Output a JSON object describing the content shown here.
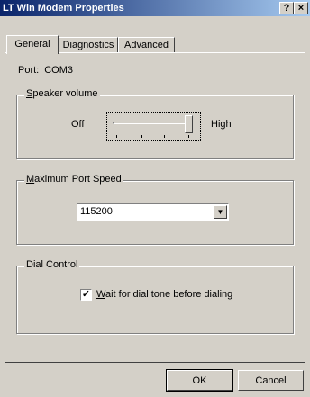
{
  "window": {
    "title": "LT Win Modem Properties",
    "help_glyph": "?",
    "close_glyph": "×"
  },
  "tabs": [
    {
      "label": "General",
      "active": true
    },
    {
      "label": "Diagnostics",
      "active": false
    },
    {
      "label": "Advanced",
      "active": false
    }
  ],
  "general": {
    "port_label": "Port:",
    "port_value": "COM3",
    "speaker": {
      "legend_hot": "S",
      "legend_rest": "peaker volume",
      "off_label": "Off",
      "high_label": "High",
      "level_fraction": 1.0,
      "tick_count": 4
    },
    "port_speed": {
      "legend_hot": "M",
      "legend_rest": "aximum Port Speed",
      "value": "115200",
      "dropdown_icon": "arrow-down-icon"
    },
    "dial_control": {
      "legend": "Dial Control",
      "checkbox_checked": true,
      "checkbox_hot": "W",
      "checkbox_rest": "ait for dial tone before dialing"
    }
  },
  "buttons": {
    "ok_label": "OK",
    "cancel_label": "Cancel"
  }
}
